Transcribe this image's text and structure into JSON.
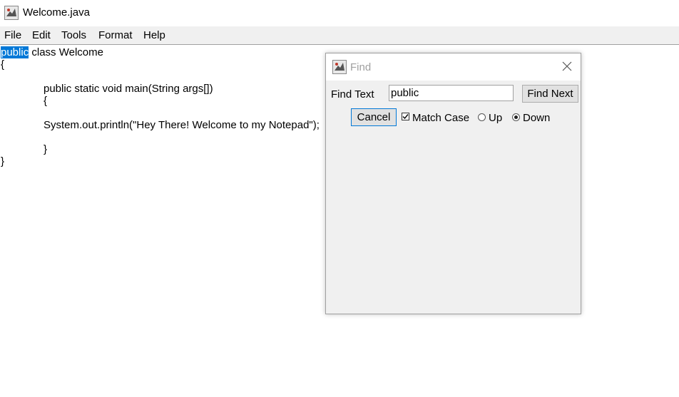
{
  "window": {
    "title": "Welcome.java"
  },
  "menubar": {
    "items": [
      "File",
      "Edit",
      "Tools",
      "Format",
      "Help"
    ]
  },
  "editor": {
    "selected_text": "public",
    "lines": [
      " class Welcome",
      "{",
      "public static void main(String args[])",
      "{",
      "System.out.println(\"Hey There! Welcome to my Notepad\");",
      "}",
      "}"
    ]
  },
  "find_dialog": {
    "title": "Find",
    "find_text_label": "Find Text",
    "find_text_value": "public",
    "find_next_label": "Find Next",
    "cancel_label": "Cancel",
    "match_case_label": "Match Case",
    "match_case_checked": true,
    "direction_up_label": "Up",
    "direction_down_label": "Down",
    "direction_selected": "Down"
  },
  "icons": {
    "app": "java-app-icon",
    "close": "close-icon"
  }
}
